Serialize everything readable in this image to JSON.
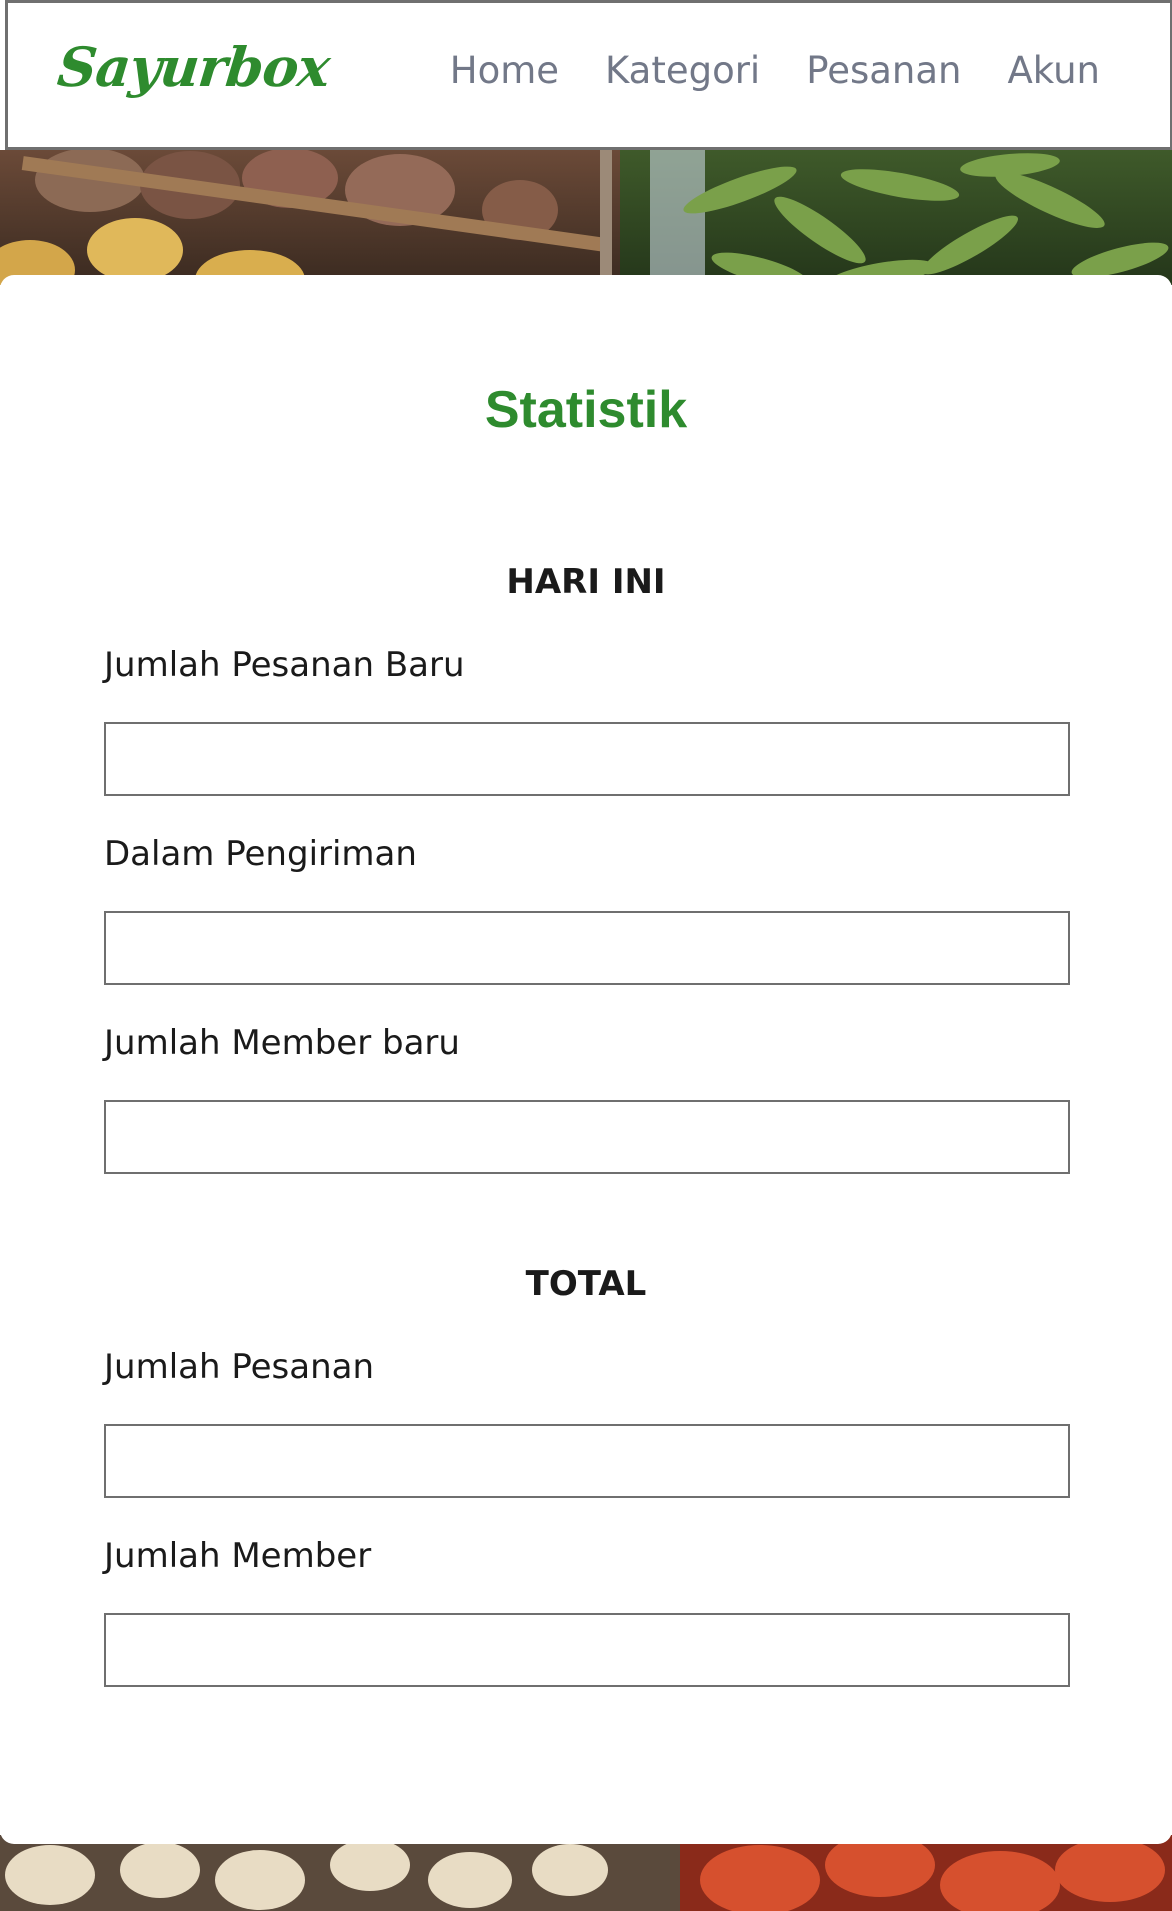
{
  "header": {
    "logo": "Sayurbox",
    "nav": [
      {
        "label": "Home"
      },
      {
        "label": "Kategori"
      },
      {
        "label": "Pesanan"
      },
      {
        "label": "Akun"
      }
    ]
  },
  "main": {
    "title": "Statistik",
    "today": {
      "heading": "HARI INI",
      "fields": [
        {
          "label": "Jumlah Pesanan Baru",
          "value": ""
        },
        {
          "label": "Dalam Pengiriman",
          "value": ""
        },
        {
          "label": "Jumlah Member baru",
          "value": ""
        }
      ]
    },
    "total": {
      "heading": "TOTAL",
      "fields": [
        {
          "label": "Jumlah Pesanan",
          "value": ""
        },
        {
          "label": "Jumlah Member",
          "value": ""
        }
      ]
    }
  },
  "colors": {
    "brand_green": "#2e8b2e",
    "nav_text": "#727888",
    "input_border": "#6f6f6f"
  }
}
